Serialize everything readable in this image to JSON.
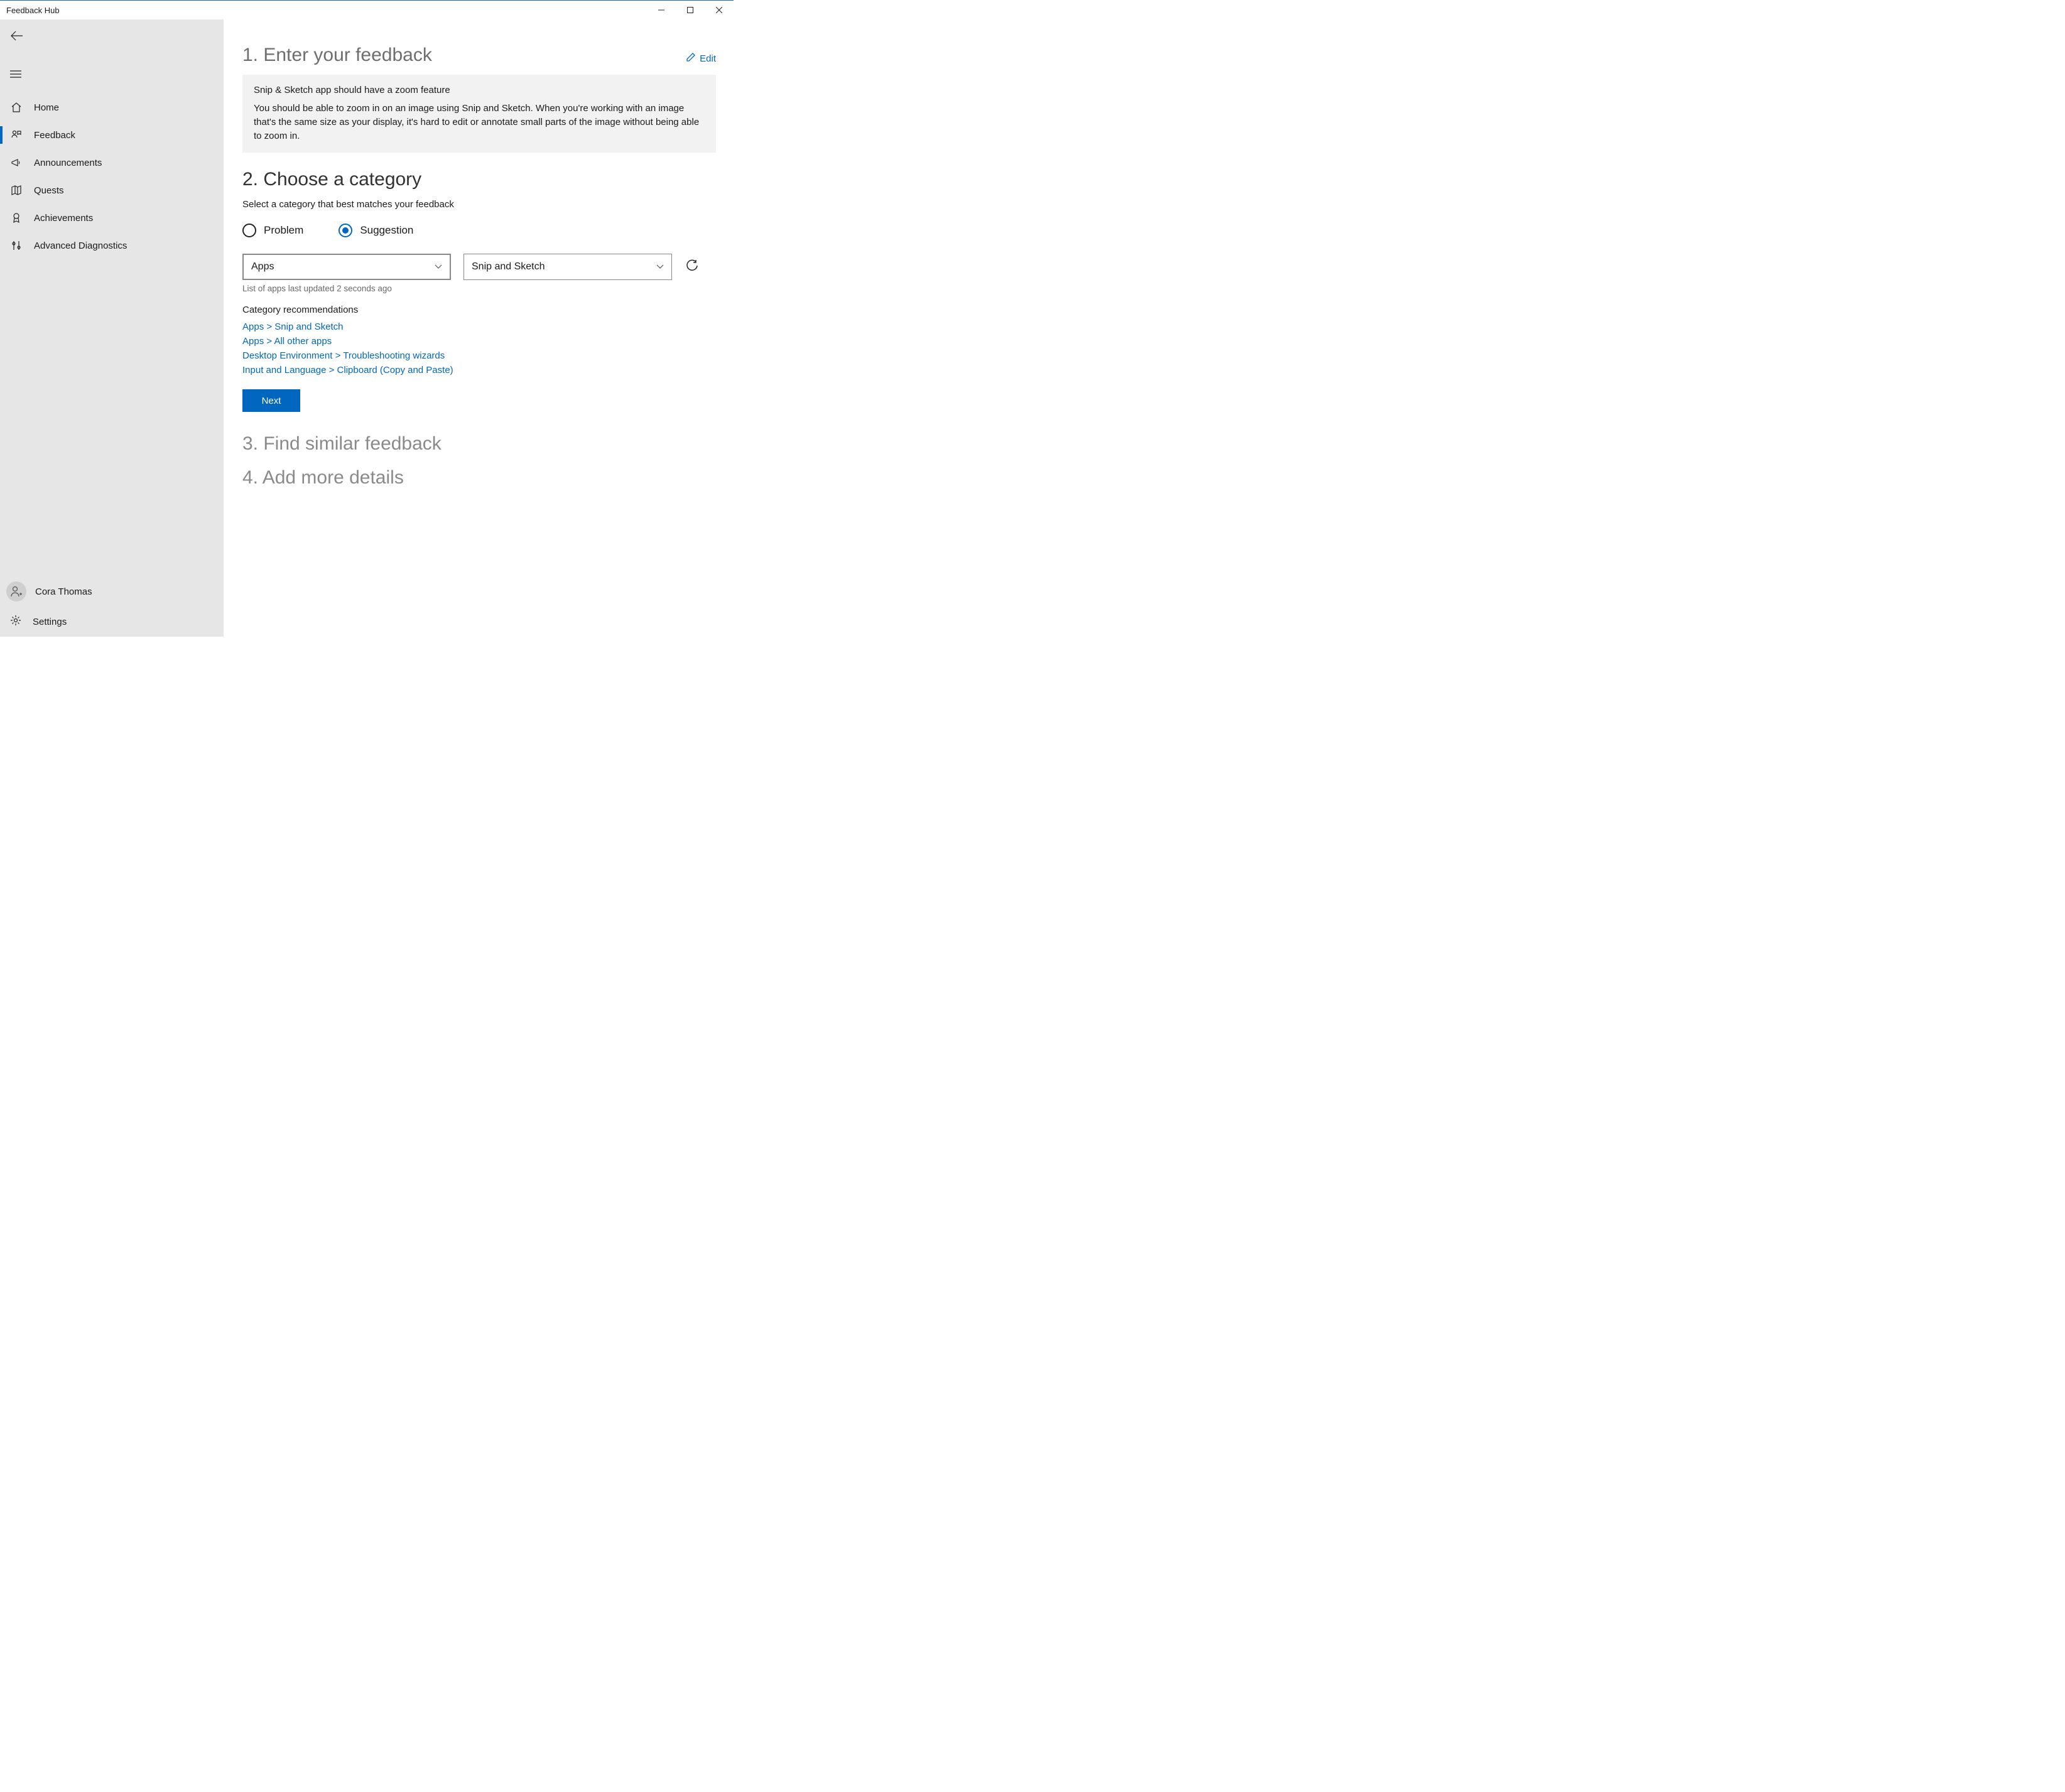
{
  "window": {
    "title": "Feedback Hub"
  },
  "sidebar": {
    "items": [
      {
        "label": "Home"
      },
      {
        "label": "Feedback"
      },
      {
        "label": "Announcements"
      },
      {
        "label": "Quests"
      },
      {
        "label": "Achievements"
      },
      {
        "label": "Advanced Diagnostics"
      }
    ],
    "user": "Cora Thomas",
    "settings": "Settings"
  },
  "steps": {
    "s1": "1. Enter your feedback",
    "s2": "2. Choose a category",
    "s3": "3. Find similar feedback",
    "s4": "4. Add more details"
  },
  "edit": "Edit",
  "feedback": {
    "title": "Snip & Sketch app should have a zoom feature",
    "body": "You should be able to zoom in on an image using Snip and Sketch. When you're working with an image that's the same size as your display, it's hard to edit or annotate small parts of the image without being able to zoom in."
  },
  "category": {
    "prompt": "Select a category that best matches your feedback",
    "radio_problem": "Problem",
    "radio_suggestion": "Suggestion",
    "select_primary": "Apps",
    "select_secondary": "Snip and Sketch",
    "updated_hint": "List of apps last updated 2 seconds ago",
    "recs_head": "Category recommendations",
    "recs": [
      "Apps > Snip and Sketch",
      "Apps > All other apps",
      "Desktop Environment > Troubleshooting wizards",
      "Input and Language > Clipboard (Copy and Paste)"
    ],
    "next": "Next"
  }
}
